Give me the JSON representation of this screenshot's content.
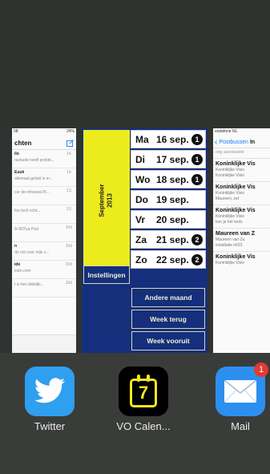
{
  "left_card": {
    "status_time": "08",
    "status_battery": "24%",
    "header": "chten",
    "rows": [
      {
        "a": "ilo",
        "b": "ractuele heeft proble...",
        "t": "14."
      },
      {
        "a": "Euuk",
        "b": "allemaal gelukt is m...",
        "t": "14."
      },
      {
        "a": "",
        "b": "cor de infosessi B...",
        "t": "13."
      },
      {
        "a": "",
        "b": "fos toch echt...",
        "t": "13."
      },
      {
        "a": "",
        "b": "Ik MO'ya Pad",
        "t": "15d"
      },
      {
        "a": "n",
        "b": "do not voor mijn v...",
        "t": "15d"
      },
      {
        "a": "ide",
        "b": "eam.com",
        "t": "15d"
      },
      {
        "a": "",
        "b": "t is het uitdelijk...",
        "t": "16d"
      }
    ]
  },
  "calendar_app": {
    "month": "September",
    "year": "2013",
    "settings_label": "Instellingen",
    "days": [
      {
        "name": "Ma",
        "date": "16 sep.",
        "badge": "1"
      },
      {
        "name": "Di",
        "date": "17 sep.",
        "badge": "1"
      },
      {
        "name": "Wo",
        "date": "18 sep.",
        "badge": "1"
      },
      {
        "name": "Do",
        "date": "19 sep.",
        "badge": ""
      },
      {
        "name": "Vr",
        "date": "20 sep.",
        "badge": ""
      },
      {
        "name": "Za",
        "date": "21 sep.",
        "badge": "2"
      },
      {
        "name": "Zo",
        "date": "22 sep.",
        "badge": "2"
      }
    ],
    "buttons": {
      "other_month": "Andere maand",
      "week_back": "Week terug",
      "week_forward": "Week vooruit"
    },
    "colors": {
      "month_bg": "#ecec1c",
      "panel_bg": "#152f7d"
    }
  },
  "right_card": {
    "status": "vodafone NL",
    "back_label": "Postbussen",
    "title": "In",
    "note": "ong aanstaande",
    "items": [
      {
        "subject": "Koninklijke Vis",
        "line1": "Koninklijke Visio",
        "line2": "Koninklijke Visio"
      },
      {
        "subject": "Koninklijke Vis",
        "line1": "Koninklijke Visio",
        "line2": "Maureen, zet"
      },
      {
        "subject": "Koninklijke Vis",
        "line1": "Koninklijke Visio",
        "line2": "kon ja het tools"
      },
      {
        "subject": "Maureen van Z",
        "line1": "Maureen van Zu",
        "line2": "installatie nIOS"
      },
      {
        "subject": "Koninklijke Vis",
        "line1": "Koninklijke Visio",
        "line2": ""
      }
    ]
  },
  "dock": {
    "apps": [
      {
        "label": "Twitter",
        "icon": "twitter-bird-icon"
      },
      {
        "label": "VO Calen...",
        "icon": "calendar-7-icon",
        "glyph": "7"
      },
      {
        "label": "Mail",
        "icon": "mail-envelope-icon",
        "badge": "1"
      }
    ]
  }
}
